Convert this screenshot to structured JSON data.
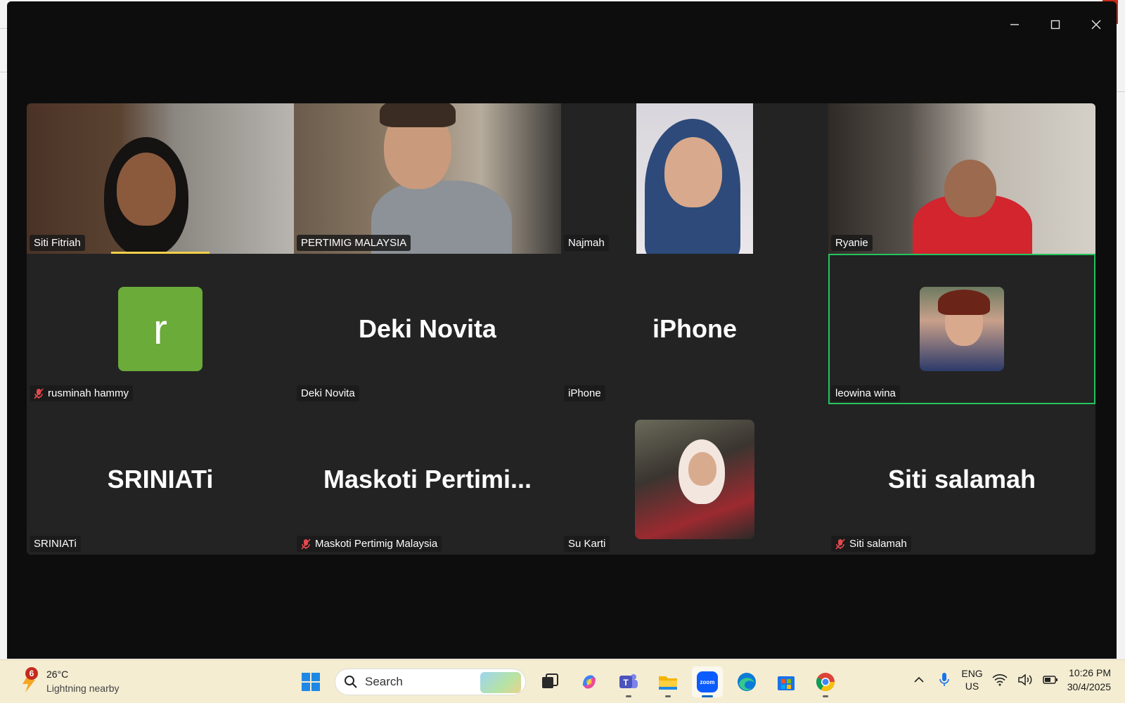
{
  "participants": [
    {
      "name": "Siti Fitriah",
      "muted": false,
      "video": true
    },
    {
      "name": "PERTIMIG MALAYSIA",
      "muted": false,
      "video": true
    },
    {
      "name": "Najmah",
      "muted": false,
      "video": true
    },
    {
      "name": "Ryanie",
      "muted": false,
      "video": true
    },
    {
      "name": "rusminah hammy",
      "muted": true,
      "avatar_letter": "r",
      "avatar_color": "#6aab3a"
    },
    {
      "name": "Deki Novita",
      "muted": false,
      "display": "Deki Novita"
    },
    {
      "name": "iPhone",
      "muted": false,
      "display": "iPhone"
    },
    {
      "name": "leowina wina",
      "muted": false,
      "active_speaker": true
    },
    {
      "name": "SRINIATi",
      "muted": false,
      "display": "SRINIATi"
    },
    {
      "name": "Maskoti Pertimig Malaysia",
      "muted": true,
      "display": "Maskoti  Pertimi..."
    },
    {
      "name": "Su Karti",
      "muted": false
    },
    {
      "name": "Siti salamah",
      "muted": true,
      "display": "Siti salamah"
    }
  ],
  "colors": {
    "active_border": "#22c55e",
    "speaking_bar": "#f2d04a",
    "mute_red": "#e5484d"
  },
  "taskbar": {
    "weather": {
      "badge": "6",
      "temp": "26°C",
      "desc": "Lightning nearby"
    },
    "search_placeholder": "Search",
    "lang_top": "ENG",
    "lang_bottom": "US",
    "time": "10:26 PM",
    "date": "30/4/2025",
    "apps": [
      "windows-start-icon",
      "search",
      "task-view-icon",
      "copilot-icon",
      "teams-icon",
      "file-explorer-icon",
      "zoom-icon",
      "edge-icon",
      "store-icon",
      "chrome-icon"
    ]
  }
}
